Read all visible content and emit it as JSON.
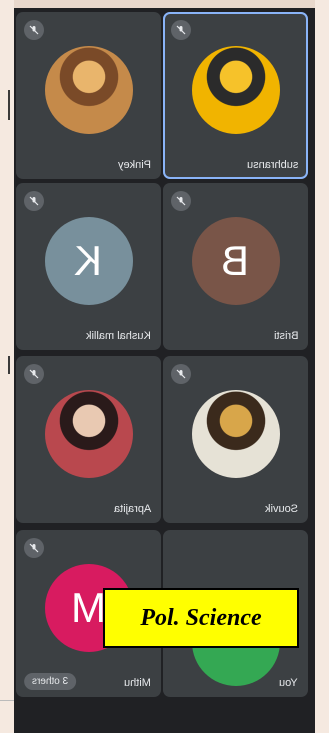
{
  "tiles": [
    {
      "name": "Pinkey",
      "type": "photo",
      "palette": [
        "#c58a4a",
        "#7a4a28",
        "#e9b56c"
      ]
    },
    {
      "name": "subhransu",
      "type": "photo",
      "palette": [
        "#f1b400",
        "#2b2b2b",
        "#f6c22a"
      ],
      "active": true
    },
    {
      "name": "Kushal mallik",
      "type": "letter",
      "letter": "K",
      "color": "#78909c"
    },
    {
      "name": "Bristi",
      "type": "letter",
      "letter": "B",
      "color": "#795548"
    },
    {
      "name": "Aprajita",
      "type": "photo",
      "palette": [
        "#b9484e",
        "#2a1a1a",
        "#e9c9b2"
      ]
    },
    {
      "name": "Souvik",
      "type": "photo",
      "palette": [
        "#e6e2d6",
        "#3b2a1c",
        "#d8a64a"
      ]
    },
    {
      "name": "Mithu",
      "type": "letter",
      "letter": "M",
      "color": "#d81b60"
    },
    {
      "name": "You",
      "type": "letter",
      "letter": "",
      "color": "#34a853"
    }
  ],
  "others_label": "3 others",
  "overlay_label": "Pol. Science",
  "colors": {
    "tile": "#3c4043",
    "background": "#202124",
    "accent": "#8ab4f8",
    "overlay": "#ffff00"
  },
  "icons": {
    "mute": "mic-off-icon"
  }
}
